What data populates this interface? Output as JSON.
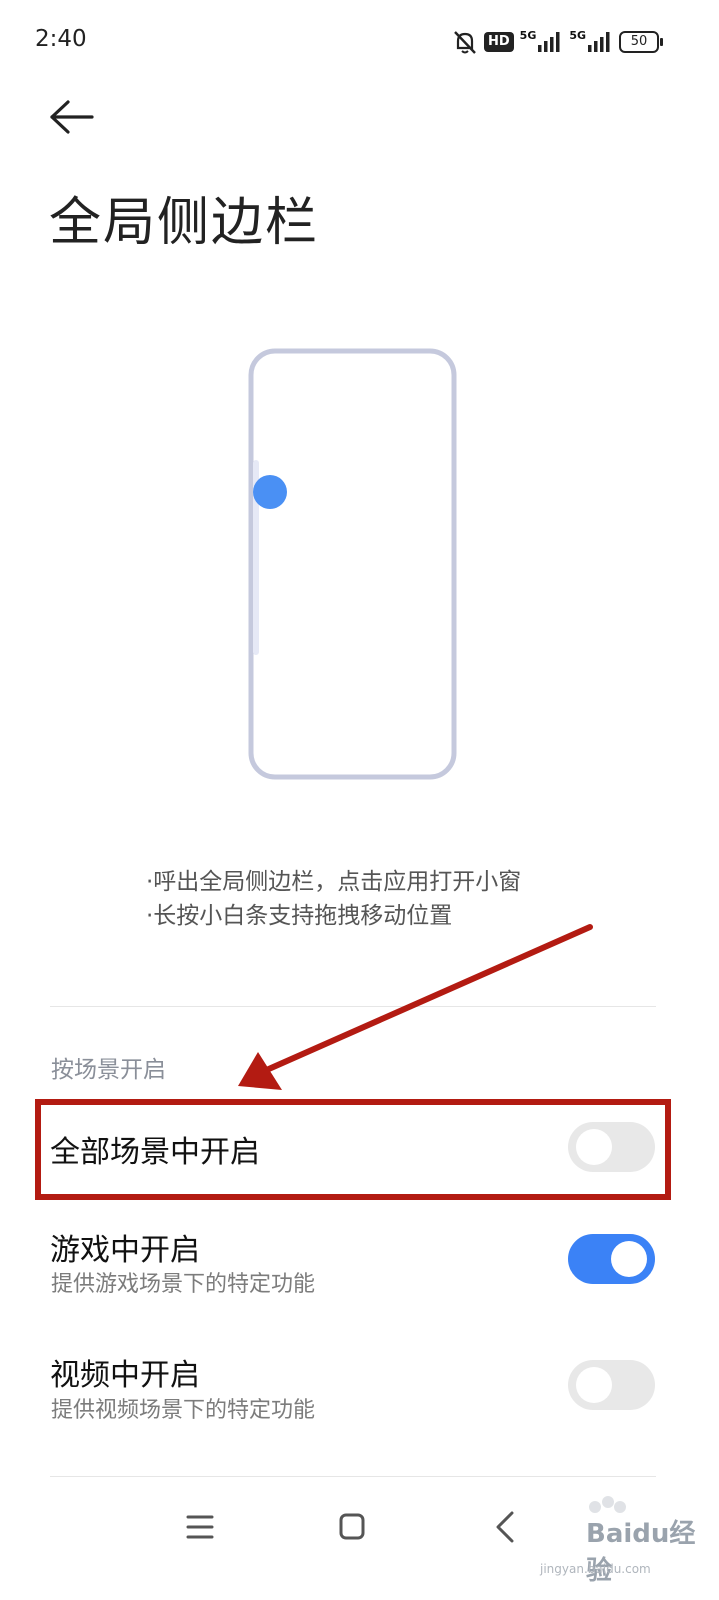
{
  "status_bar": {
    "time": "2:40",
    "hd_label": "HD",
    "network1": "5G",
    "network2": "5G",
    "battery": "50"
  },
  "header": {
    "back_icon": "arrow-left-icon",
    "title": "全局侧边栏"
  },
  "illustration": {
    "frame_color": "#c5c9dd",
    "dot_color": "#4a90f4"
  },
  "description": {
    "line1": "·呼出全局侧边栏，点击应用打开小窗",
    "line2": "·长按小白条支持拖拽移动位置"
  },
  "section": {
    "header": "按场景开启",
    "items": [
      {
        "title": "全部场景中开启",
        "subtitle": "",
        "enabled": false
      },
      {
        "title": "游戏中开启",
        "subtitle": "提供游戏场景下的特定功能",
        "enabled": true
      },
      {
        "title": "视频中开启",
        "subtitle": "提供视频场景下的特定功能",
        "enabled": false
      }
    ]
  },
  "annotation": {
    "color": "#b31b12"
  },
  "nav": {
    "menu_icon": "menu-icon",
    "home_icon": "home-icon",
    "back_icon": "back-chevron-icon"
  },
  "watermark": {
    "text": "Baidu经验",
    "url": "jingyan.baidu.com"
  }
}
